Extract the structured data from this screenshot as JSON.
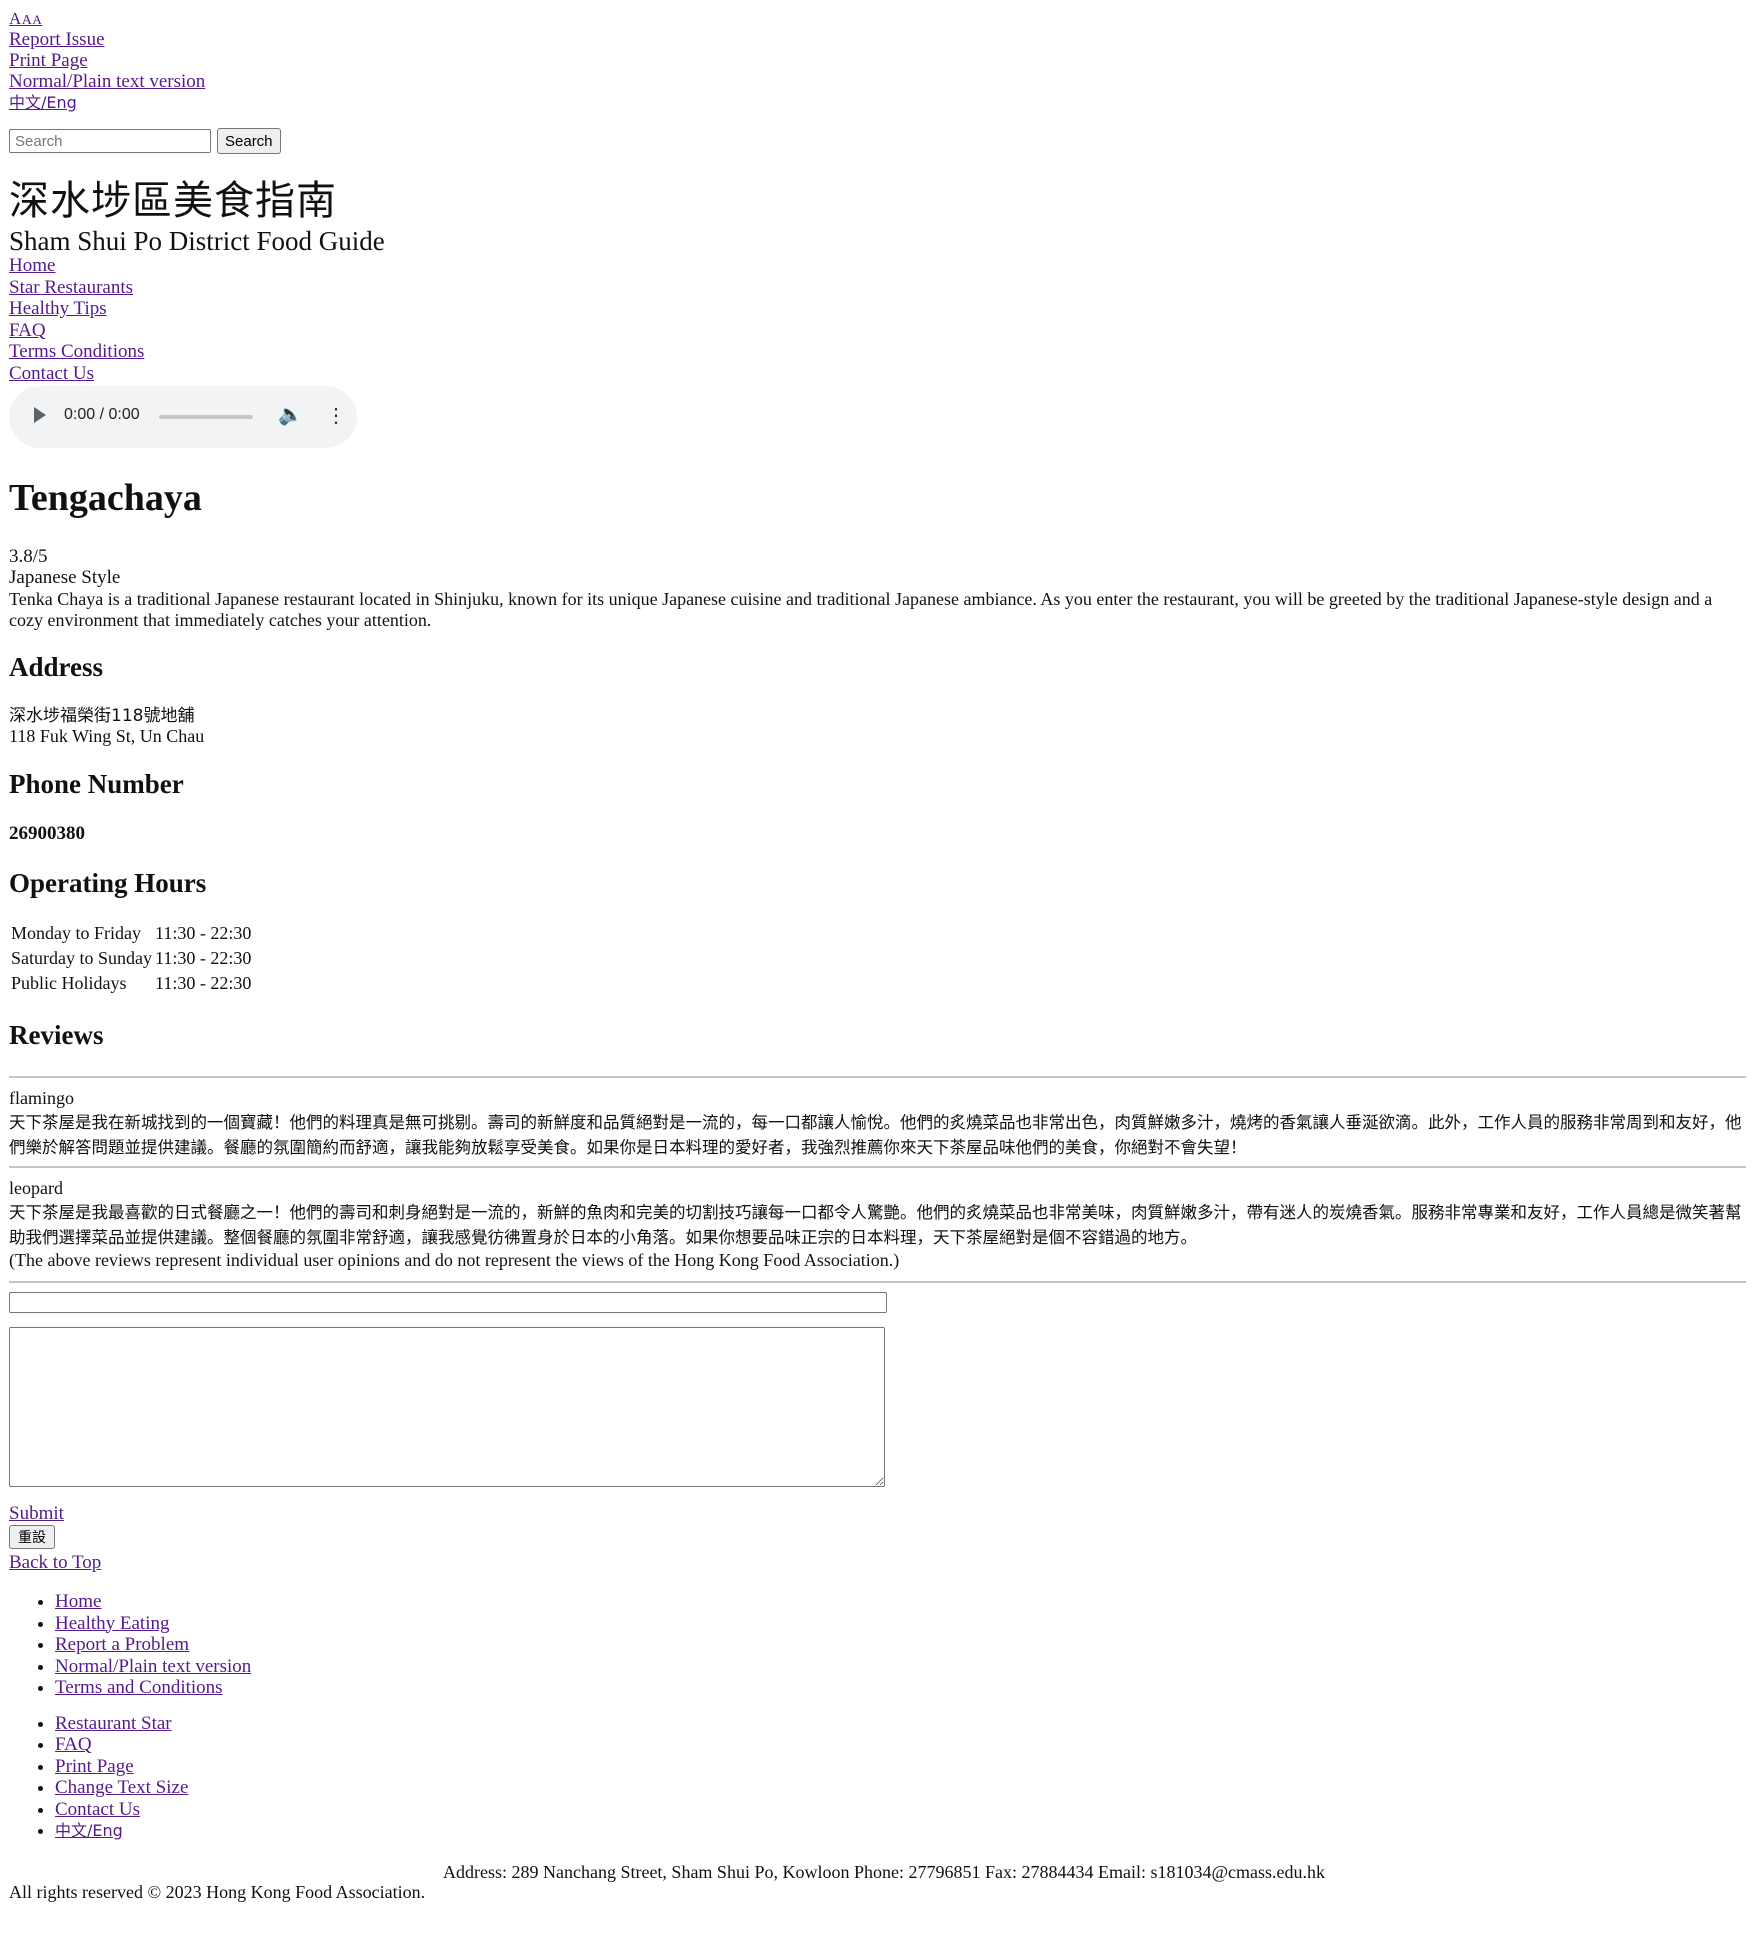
{
  "toolbar": {
    "font_size_a1": "A",
    "font_size_a2": "A",
    "font_size_a3": "A",
    "report_issue": "Report Issue",
    "print_page": "Print Page",
    "plain_text": "Normal/Plain text version",
    "language": "中文/Eng"
  },
  "search": {
    "placeholder": "Search",
    "value": "",
    "button_label": "Search"
  },
  "site": {
    "title_zh": "深水埗區美食指南",
    "title_en": "Sham Shui Po District Food Guide"
  },
  "nav": {
    "items": [
      "Home",
      "Star Restaurants",
      "Healthy Tips",
      "FAQ",
      "Terms Conditions",
      "Contact Us"
    ]
  },
  "audio": {
    "time": "0:00 / 0:00"
  },
  "restaurant": {
    "name": "Tengachaya",
    "rating": "3.8/5",
    "style": "Japanese Style",
    "description": "Tenka Chaya is a traditional Japanese restaurant located in Shinjuku, known for its unique Japanese cuisine and traditional Japanese ambiance. As you enter the restaurant, you will be greeted by the traditional Japanese-style design and a cozy environment that immediately catches your attention.",
    "address_heading": "Address",
    "address_zh": "深水埗福榮街118號地舖",
    "address_en": "118 Fuk Wing St, Un Chau",
    "phone_heading": "Phone Number",
    "phone": "26900380",
    "hours_heading": "Operating Hours",
    "hours": [
      {
        "day": "Monday to Friday",
        "time": "11:30 - 22:30"
      },
      {
        "day": "Saturday to Sunday",
        "time": "11:30 - 22:30"
      },
      {
        "day": "Public Holidays",
        "time": "11:30 - 22:30"
      }
    ]
  },
  "reviews": {
    "heading": "Reviews",
    "items": [
      {
        "user": "flamingo",
        "text": "天下茶屋是我在新城找到的一個寶藏！他們的料理真是無可挑剔。壽司的新鮮度和品質絕對是一流的，每一口都讓人愉悅。他們的炙燒菜品也非常出色，肉質鮮嫩多汁，燒烤的香氣讓人垂涎欲滴。此外，工作人員的服務非常周到和友好，他們樂於解答問題並提供建議。餐廳的氛圍簡約而舒適，讓我能夠放鬆享受美食。如果你是日本料理的愛好者，我強烈推薦你來天下茶屋品味他們的美食，你絕對不會失望！"
      },
      {
        "user": "leopard",
        "text": "天下茶屋是我最喜歡的日式餐廳之一！他們的壽司和刺身絕對是一流的，新鮮的魚肉和完美的切割技巧讓每一口都令人驚艷。他們的炙燒菜品也非常美味，肉質鮮嫩多汁，帶有迷人的炭燒香氣。服務非常專業和友好，工作人員總是微笑著幫助我們選擇菜品並提供建議。整個餐廳的氛圍非常舒適，讓我感覺彷彿置身於日本的小角落。如果你想要品味正宗的日本料理，天下茶屋絕對是個不容錯過的地方。"
      }
    ],
    "disclaimer": "(The above reviews represent individual user opinions and do not represent the views of the Hong Kong Food Association.)"
  },
  "form": {
    "title_value": "",
    "body_value": "",
    "submit_label": "Submit",
    "reset_label": "重設"
  },
  "back_to_top": "Back to Top",
  "footer": {
    "list1": [
      "Home",
      "Healthy Eating",
      "Report a Problem",
      "Normal/Plain text version",
      "Terms and Conditions"
    ],
    "list2": [
      "Restaurant Star",
      "FAQ",
      "Print Page",
      "Change Text Size",
      "Contact Us",
      "中文/Eng"
    ],
    "contact": "Address: 289 Nanchang Street, Sham Shui Po, Kowloon Phone: 27796851 Fax: 27884434 Email: s181034@cmass.edu.hk",
    "rights": "All rights reserved © 2023 Hong Kong Food Association."
  },
  "colors": {
    "link": "#551a8b",
    "divider": "#c4c4c4",
    "audio_bg": "#f1f3f4"
  }
}
